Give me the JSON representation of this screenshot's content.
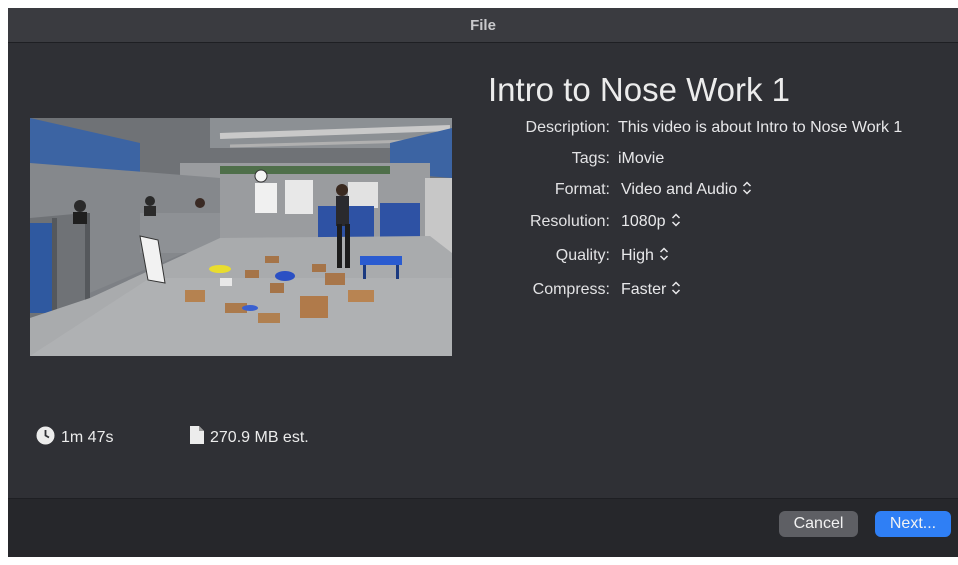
{
  "window": {
    "title": "File"
  },
  "video": {
    "title": "Intro to Nose Work 1",
    "thumbnail": "video-thumbnail-gym-scene"
  },
  "properties": [
    {
      "label": "Description:",
      "value": "This video is about Intro to Nose Work 1",
      "popup": false
    },
    {
      "label": "Tags:",
      "value": "iMovie",
      "popup": false
    },
    {
      "label": "Format:",
      "value": "Video and Audio",
      "popup": true
    },
    {
      "label": "Resolution:",
      "value": "1080p",
      "popup": true
    },
    {
      "label": "Quality:",
      "value": "High",
      "popup": true
    },
    {
      "label": "Compress:",
      "value": "Faster",
      "popup": true
    }
  ],
  "stats": {
    "duration": "1m 47s",
    "duration_icon": "clock-icon",
    "size": "270.9 MB est.",
    "size_icon": "document-icon"
  },
  "buttons": {
    "cancel": "Cancel",
    "next": "Next..."
  },
  "colors": {
    "accent": "#2f7ff5",
    "window_bg": "#2f3035",
    "footer_bg": "#26272b"
  }
}
